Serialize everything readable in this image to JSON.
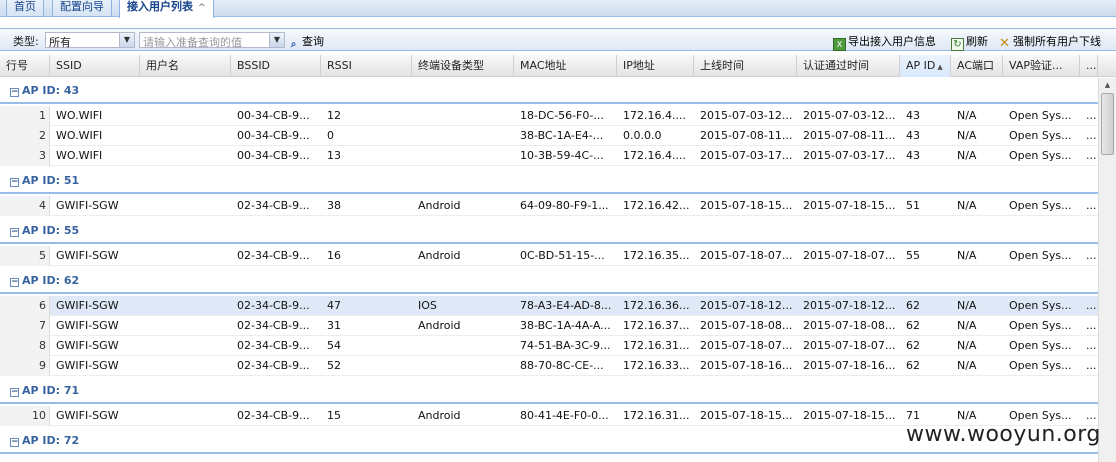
{
  "tabs": [
    {
      "label": "首页"
    },
    {
      "label": "配置向导"
    },
    {
      "label": "接入用户列表",
      "close": "^"
    }
  ],
  "toolbar": {
    "type_label": "类型:",
    "type_value": "所有",
    "search_placeholder": "请输入准备查询的值",
    "query_label": "查询",
    "export_label": "导出接入用户信息",
    "refresh_label": "刷新",
    "kick_label": "强制所有用户下线"
  },
  "columns": [
    "行号",
    "SSID",
    "用户名",
    "BSSID",
    "RSSI",
    "终端设备类型",
    "MAC地址",
    "IP地址",
    "上线时间",
    "认证通过时间",
    "AP ID",
    "AC端口",
    "VAP验证...",
    "..."
  ],
  "groups": [
    {
      "title": "AP ID: 43",
      "rows": [
        [
          "1",
          "WO.WIFI",
          "",
          "00-34-CB-9...",
          "12",
          "",
          "18-DC-56-F0-...",
          "172.16.4....",
          "2015-07-03-12...",
          "2015-07-03-12...",
          "43",
          "N/A",
          "Open Sys...",
          "..."
        ],
        [
          "2",
          "WO.WIFI",
          "",
          "00-34-CB-9...",
          "0",
          "",
          "38-BC-1A-E4-...",
          "0.0.0.0",
          "2015-07-08-11...",
          "2015-07-08-11...",
          "43",
          "N/A",
          "Open Sys...",
          "..."
        ],
        [
          "3",
          "WO.WIFI",
          "",
          "00-34-CB-9...",
          "13",
          "",
          "10-3B-59-4C-...",
          "172.16.4....",
          "2015-07-03-17...",
          "2015-07-03-17...",
          "43",
          "N/A",
          "Open Sys...",
          "..."
        ]
      ]
    },
    {
      "title": "AP ID: 51",
      "rows": [
        [
          "4",
          "GWIFI-SGW",
          "",
          "02-34-CB-9...",
          "38",
          "Android",
          "64-09-80-F9-1...",
          "172.16.42...",
          "2015-07-18-15...",
          "2015-07-18-15...",
          "51",
          "N/A",
          "Open Sys...",
          "..."
        ]
      ]
    },
    {
      "title": "AP ID: 55",
      "rows": [
        [
          "5",
          "GWIFI-SGW",
          "",
          "02-34-CB-9...",
          "16",
          "Android",
          "0C-BD-51-15-...",
          "172.16.35...",
          "2015-07-18-07...",
          "2015-07-18-07...",
          "55",
          "N/A",
          "Open Sys...",
          "..."
        ]
      ]
    },
    {
      "title": "AP ID: 62",
      "rows": [
        [
          "6",
          "GWIFI-SGW",
          "",
          "02-34-CB-9...",
          "47",
          "IOS",
          "78-A3-E4-AD-8...",
          "172.16.36...",
          "2015-07-18-12...",
          "2015-07-18-12...",
          "62",
          "N/A",
          "Open Sys...",
          "..."
        ],
        [
          "7",
          "GWIFI-SGW",
          "",
          "02-34-CB-9...",
          "31",
          "Android",
          "38-BC-1A-4A-A...",
          "172.16.37...",
          "2015-07-18-08...",
          "2015-07-18-08...",
          "62",
          "N/A",
          "Open Sys...",
          "..."
        ],
        [
          "8",
          "GWIFI-SGW",
          "",
          "02-34-CB-9...",
          "54",
          "",
          "74-51-BA-3C-9...",
          "172.16.31...",
          "2015-07-18-07...",
          "2015-07-18-07...",
          "62",
          "N/A",
          "Open Sys...",
          "..."
        ],
        [
          "9",
          "GWIFI-SGW",
          "",
          "02-34-CB-9...",
          "52",
          "",
          "88-70-8C-CE-...",
          "172.16.33...",
          "2015-07-18-16...",
          "2015-07-18-16...",
          "62",
          "N/A",
          "Open Sys...",
          "..."
        ]
      ]
    },
    {
      "title": "AP ID: 71",
      "rows": [
        [
          "10",
          "GWIFI-SGW",
          "",
          "02-34-CB-9...",
          "15",
          "Android",
          "80-41-4E-F0-0...",
          "172.16.31...",
          "2015-07-18-15...",
          "2015-07-18-15...",
          "71",
          "N/A",
          "Open Sys...",
          "..."
        ]
      ]
    },
    {
      "title": "AP ID: 72",
      "rows": []
    }
  ],
  "watermark": "www.wooyun.org"
}
